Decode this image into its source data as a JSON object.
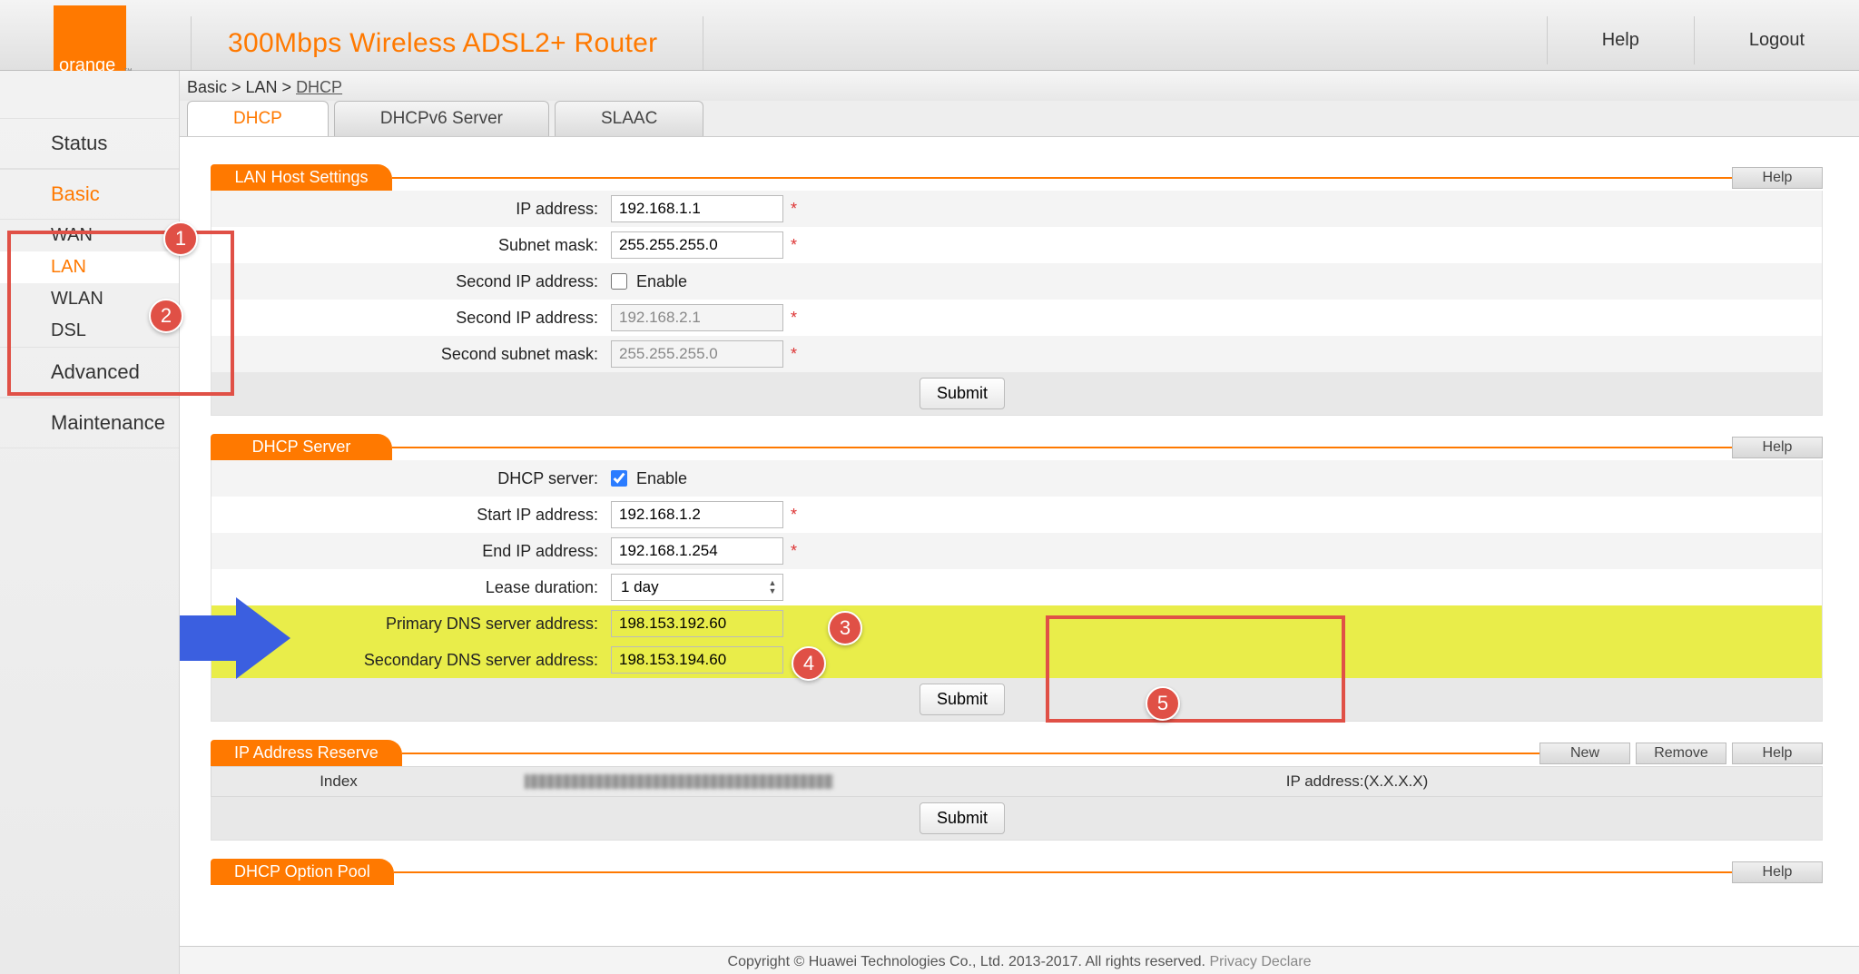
{
  "brand": "orange",
  "header": {
    "title": "300Mbps Wireless ADSL2+ Router",
    "help": "Help",
    "logout": "Logout"
  },
  "breadcrumbs": {
    "a": "Basic",
    "b": "LAN",
    "c": "DHCP",
    "sep": " > "
  },
  "tabs": {
    "dhcp": "DHCP",
    "dhcpv6": "DHCPv6 Server",
    "slaac": "SLAAC"
  },
  "sidebar": {
    "status": "Status",
    "basic": "Basic",
    "wan": "WAN",
    "lan": "LAN",
    "wlan": "WLAN",
    "dsl": "DSL",
    "advanced": "Advanced",
    "maintenance": "Maintenance"
  },
  "buttons": {
    "help": "Help",
    "submit": "Submit",
    "new": "New",
    "remove": "Remove"
  },
  "lan": {
    "title": "LAN Host Settings",
    "ip_label": "IP address:",
    "ip_value": "192.168.1.1",
    "mask_label": "Subnet mask:",
    "mask_value": "255.255.255.0",
    "second_enable_label": "Second IP address:",
    "enable_text": "Enable",
    "second_ip_label": "Second IP address:",
    "second_ip_value": "192.168.2.1",
    "second_mask_label": "Second subnet mask:",
    "second_mask_value": "255.255.255.0"
  },
  "dhcp": {
    "title": "DHCP Server",
    "server_label": "DHCP server:",
    "enable_text": "Enable",
    "start_label": "Start IP address:",
    "start_value": "192.168.1.2",
    "end_label": "End IP address:",
    "end_value": "192.168.1.254",
    "lease_label": "Lease duration:",
    "lease_value": "1 day",
    "pri_dns_label": "Primary DNS server address:",
    "pri_dns_value": "198.153.192.60",
    "sec_dns_label": "Secondary DNS server address:",
    "sec_dns_value": "198.153.194.60"
  },
  "reserve": {
    "title": "IP Address Reserve",
    "col_index": "Index",
    "col_ip": "IP address:(X.X.X.X)"
  },
  "option_pool": {
    "title": "DHCP Option Pool"
  },
  "footer": {
    "text": "Copyright © Huawei Technologies Co., Ltd. 2013-2017. All rights reserved. ",
    "privacy": "Privacy Declare"
  },
  "annotations": {
    "b1": "1",
    "b2": "2",
    "b3": "3",
    "b4": "4",
    "b5": "5"
  },
  "asterisk": "*"
}
